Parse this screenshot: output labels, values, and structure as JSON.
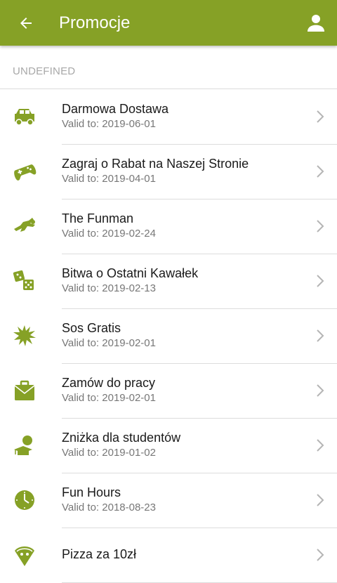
{
  "appbar": {
    "title": "Promocje",
    "color": "#86a126",
    "back_icon": "arrow-left-icon",
    "user_icon": "user-icon"
  },
  "section": {
    "label": "UNDEFINED"
  },
  "promos": [
    {
      "name": "Darmowa Dostawa",
      "valid": "Valid to: 2019-06-01",
      "icon": "car-icon"
    },
    {
      "name": "Zagraj o Rabat na Naszej Stronie",
      "valid": "Valid to: 2019-04-01",
      "icon": "gamepad-icon"
    },
    {
      "name": "The Funman",
      "valid": "Valid to: 2019-02-24",
      "icon": "flying-hero-icon"
    },
    {
      "name": "Bitwa o Ostatni Kawałek",
      "valid": "Valid to: 2019-02-13",
      "icon": "dice-icon"
    },
    {
      "name": "Sos Gratis",
      "valid": "Valid to: 2019-02-01",
      "icon": "splash-icon"
    },
    {
      "name": "Zamów do pracy",
      "valid": "Valid to: 2019-02-01",
      "icon": "briefcase-icon"
    },
    {
      "name": "Zniżka dla studentów",
      "valid": "Valid to: 2019-01-02",
      "icon": "student-cap-icon"
    },
    {
      "name": "Fun Hours",
      "valid": "Valid to: 2018-08-23",
      "icon": "clock-icon"
    },
    {
      "name": "Pizza za 10zł",
      "valid": "",
      "icon": "pizza-icon"
    }
  ]
}
